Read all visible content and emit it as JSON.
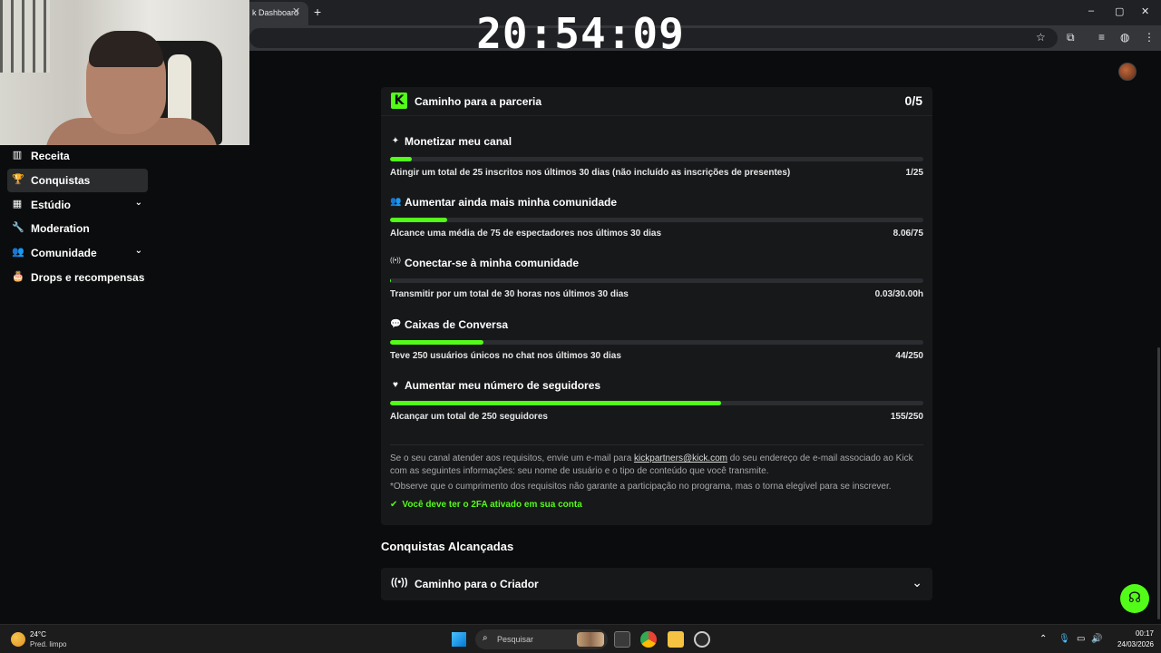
{
  "browser": {
    "tab_label": "k Dashboard",
    "tab_close": "✕",
    "new_tab": "+",
    "window_controls": [
      "–",
      "▢",
      "✕"
    ]
  },
  "overlay": {
    "clock": "20:54:09"
  },
  "sidebar": {
    "items": [
      {
        "label": "Receita",
        "icon": "bar-chart-icon",
        "glyph": "▥",
        "expandable": false,
        "active": false
      },
      {
        "label": "Conquistas",
        "icon": "trophy-icon",
        "glyph": "🏆",
        "expandable": false,
        "active": true
      },
      {
        "label": "Estúdio",
        "icon": "studio-icon",
        "glyph": "▦",
        "expandable": true,
        "active": false
      },
      {
        "label": "Moderation",
        "icon": "wrench-icon",
        "glyph": "🔧",
        "expandable": false,
        "active": false
      },
      {
        "label": "Comunidade",
        "icon": "community-icon",
        "glyph": "👥",
        "expandable": true,
        "active": false
      },
      {
        "label": "Drops e recompensas",
        "icon": "drops-icon",
        "glyph": "🎂",
        "expandable": false,
        "active": false
      }
    ]
  },
  "partnership": {
    "title": "Caminho para a parceria",
    "progress": "0/5",
    "requirements": [
      {
        "icon": "sparkle-icon",
        "glyph": "✦",
        "title": "Monetizar meu canal",
        "description": "Atingir um total de 25 inscritos nos últimos 30 dias (não incluído as inscrições de presentes)",
        "value": "1/25",
        "fraction": 0.04
      },
      {
        "icon": "community-icon",
        "glyph": "👥",
        "title": "Aumentar ainda mais minha comunidade",
        "description": "Alcance uma média de 75 de espectadores nos últimos 30 dias",
        "value": "8.06/75",
        "fraction": 0.1075
      },
      {
        "icon": "broadcast-icon",
        "glyph": "((•))",
        "title": "Conectar-se à minha comunidade",
        "description": "Transmitir por um total de 30 horas nos últimos 30 dias",
        "value": "0.03/30.00h",
        "fraction": 0.001
      },
      {
        "icon": "chat-icon",
        "glyph": "💬",
        "title": "Caixas de Conversa",
        "description": "Teve 250 usuários únicos no chat nos últimos 30 dias",
        "value": "44/250",
        "fraction": 0.176
      },
      {
        "icon": "heart-icon",
        "glyph": "♥",
        "title": "Aumentar meu número de seguidores",
        "description": "Alcançar um total de 250 seguidores",
        "value": "155/250",
        "fraction": 0.62
      }
    ],
    "info_before_link": "Se o seu canal atender aos requisitos, envie um e-mail para ",
    "info_link": "kickpartners@kick.com",
    "info_after_link": " do seu endereço de e-mail associado ao Kick com as seguintes informações: seu nome de usuário e o tipo de conteúdo que você transmite.",
    "note": "*Observe que o cumprimento dos requisitos não garante a participação no programa, mas o torna elegível para se inscrever.",
    "twofa": "Você deve ter o 2FA ativado em sua conta"
  },
  "achievements": {
    "title": "Conquistas Alcançadas",
    "items": [
      {
        "label": "Caminho para o Criador",
        "icon": "broadcast-icon"
      }
    ]
  },
  "taskbar": {
    "weather_temp": "24°C",
    "weather_desc": "Pred. limpo",
    "search_placeholder": "Pesquisar",
    "time": "00:17",
    "date": "24/03/2026"
  },
  "colors": {
    "accent": "#53fc18",
    "background": "#0b0c0d",
    "card": "#17181a"
  }
}
